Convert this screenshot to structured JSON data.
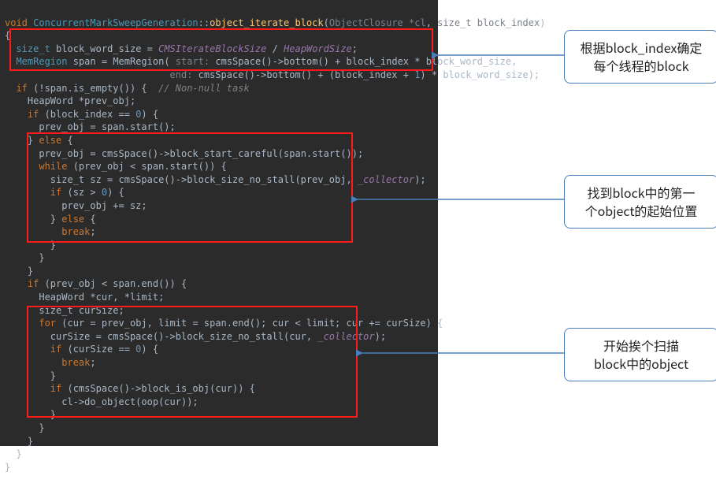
{
  "callouts": [
    {
      "line1": "根据block_index确定",
      "line2": "每个线程的block"
    },
    {
      "line1": "找到block中的第一",
      "line2": "个object的起始位置"
    },
    {
      "line1": "开始挨个扫描",
      "line2": "block中的object"
    }
  ],
  "code": {
    "l1_kw1": "void",
    "l1_cls": "ConcurrentMarkSweepGeneration",
    "l1_fn": "object_iterate_block",
    "l1_p1t": "ObjectClosure",
    "l1_p1n": "*cl",
    "l1_p2t": "size_t",
    "l1_p2n": "block_index",
    "l2_ty": "size_t",
    "l2_var": "block_word_size",
    "l2_eq": " = ",
    "l2_c1": "CMSIterateBlockSize",
    "l2_div": " / ",
    "l2_c2": "HeapWordSize",
    "l2_end": ";",
    "l3_ty": "MemRegion",
    "l3_var": "span",
    "l3_assign": " = ",
    "l3_ctor": "MemRegion",
    "l3_open": "(",
    "l3_hint1": " start:",
    "l3_a1": " cmsSpace()->bottom() + block_index * block_word_size",
    "l3_comma": ",",
    "l4_hint2": "end:",
    "l4_a2": " cmsSpace()->bottom() + (block_index + ",
    "l4_num1": "1",
    "l4_a2b": ") * block_word_size);",
    "l5_if": "if",
    "l5_cond": " (!span.is_empty()) {",
    "l5_cm": "  // Non-null task",
    "l6": "HeapWord *prev_obj;",
    "l7_if": "if",
    "l7_cond": " (block_index == ",
    "l7_num0": "0",
    "l7_close": ") {",
    "l8": "prev_obj = span.start();",
    "l9_else": "} ",
    "l9_elsekw": "else",
    "l9_brace": " {",
    "l10": "prev_obj = cmsSpace()->block_start_careful(span.start());",
    "l11_while": "while",
    "l11_cond": " (prev_obj < span.start()) {",
    "l12_pre": "size_t sz = cmsSpace()->block_size_no_stall(prev_obj, ",
    "l12_coll": "_collector",
    "l12_post": ");",
    "l13_if": "if",
    "l13_cond": " (sz > ",
    "l13_num0": "0",
    "l13_close": ") {",
    "l14": "prev_obj += sz;",
    "l15_else": "} ",
    "l15_elsekw": "else",
    "l15_brace": " {",
    "l16_break": "break",
    "l16_semi": ";",
    "l17": "}",
    "l18": "}",
    "l19": "}",
    "l20_if": "if",
    "l20_cond": " (prev_obj < span.end()) {",
    "l21": "HeapWord *cur, *limit;",
    "l22": "size_t curSize;",
    "l23_for": "for",
    "l23_cond": " (cur = prev_obj, limit = span.end(); cur < limit; cur += curSize) {",
    "l24_pre": "curSize = cmsSpace()->block_size_no_stall(cur, ",
    "l24_coll": "_collector",
    "l24_post": ");",
    "l25_if": "if",
    "l25_cond": " (curSize == ",
    "l25_num0": "0",
    "l25_close": ") {",
    "l26_break": "break",
    "l26_semi": ";",
    "l27": "}",
    "l28_if": "if",
    "l28_cond": " (cmsSpace()->block_is_obj(cur)) {",
    "l29": "cl->do_object(oop(cur));",
    "l30": "}",
    "l31": "}",
    "l32": "}",
    "l33": "}",
    "l34": "}"
  }
}
